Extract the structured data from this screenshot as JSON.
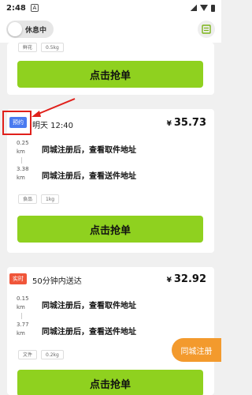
{
  "status_bar": {
    "time": "2:48",
    "warn_glyph": "A"
  },
  "header": {
    "toggle_label": "休息中"
  },
  "card_top": {
    "tags": [
      "鲜花",
      "0.5kg"
    ],
    "button": "点击抢单"
  },
  "card_2": {
    "badge": "预约",
    "time": "明天 12:40",
    "price_symbol": "¥",
    "price": "35.73",
    "pickup": {
      "distance": "0.25",
      "unit": "km",
      "address": "同城注册后，查看取件地址"
    },
    "delivery": {
      "distance": "3.38",
      "unit": "km",
      "address": "同城注册后，查看送件地址"
    },
    "tags": [
      "食品",
      "1kg"
    ],
    "button": "点击抢单"
  },
  "card_3": {
    "badge": "实时",
    "time": "50分钟内送达",
    "price_symbol": "¥",
    "price": "32.92",
    "pickup": {
      "distance": "0.15",
      "unit": "km",
      "address": "同城注册后，查看取件地址"
    },
    "delivery": {
      "distance": "3.77",
      "unit": "km",
      "address": "同城注册后，查看送件地址"
    },
    "tags": [
      "文件",
      "0.2kg"
    ],
    "button": "点击抢单"
  },
  "fab_label": "同城注册",
  "colors": {
    "accent_green": "#8fd11f",
    "badge_blue": "#4a7bf0",
    "badge_red": "#f0563a",
    "fab_orange": "#f39a2d",
    "annotation_red": "#e0201b"
  }
}
